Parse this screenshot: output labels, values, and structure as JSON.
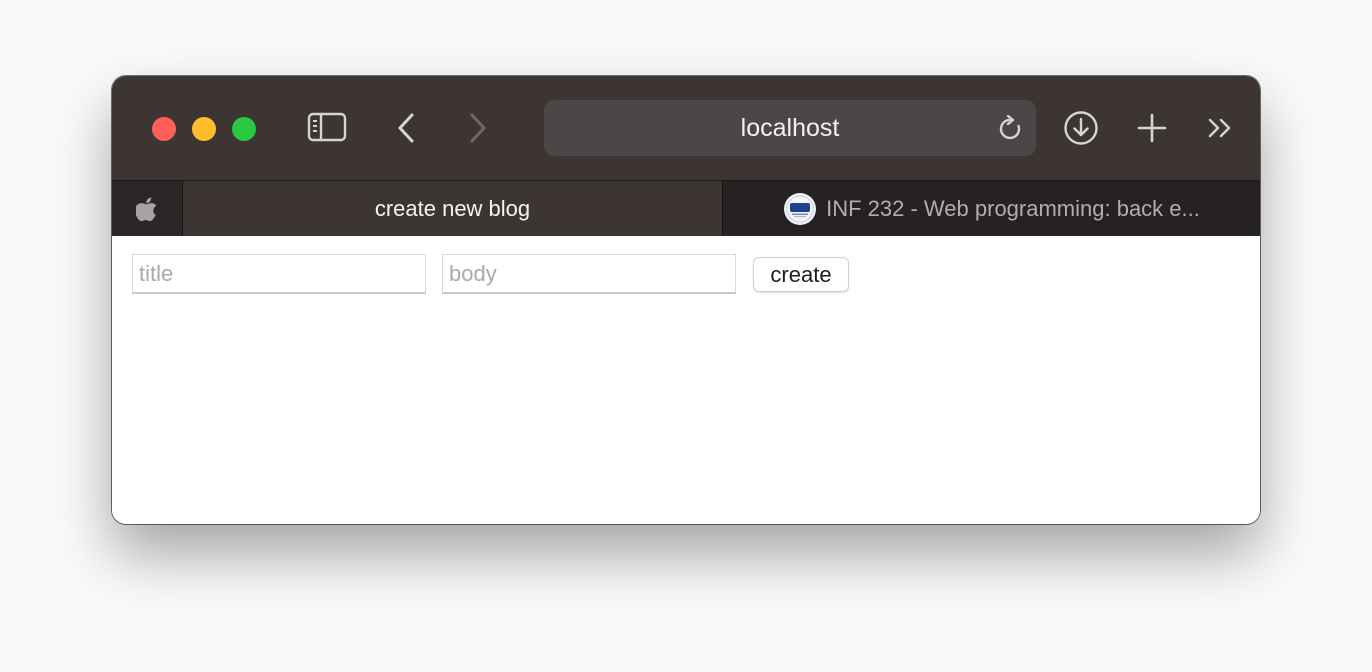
{
  "browser": {
    "address": "localhost",
    "colors": {
      "toolbar": "#3c3534",
      "tabbar": "#262221",
      "close": "#fe5f57",
      "minimize": "#febc2e",
      "zoom": "#28c840"
    },
    "toolbar_icons": [
      "sidebar-icon",
      "back-arrow-icon",
      "forward-arrow-icon",
      "reload-icon",
      "download-icon",
      "new-tab-plus-icon",
      "overflow-chevrons-icon"
    ],
    "pinned_tab_icon": "apple-logo-icon",
    "tabs": [
      {
        "title": "create new blog",
        "active": true
      },
      {
        "title": "INF 232 - Web programming: back e...",
        "active": false,
        "favicon": "sdu-logo-icon"
      }
    ]
  },
  "page": {
    "form": {
      "title_placeholder": "title",
      "title_value": "",
      "body_placeholder": "body",
      "body_value": "",
      "create_label": "create"
    }
  }
}
